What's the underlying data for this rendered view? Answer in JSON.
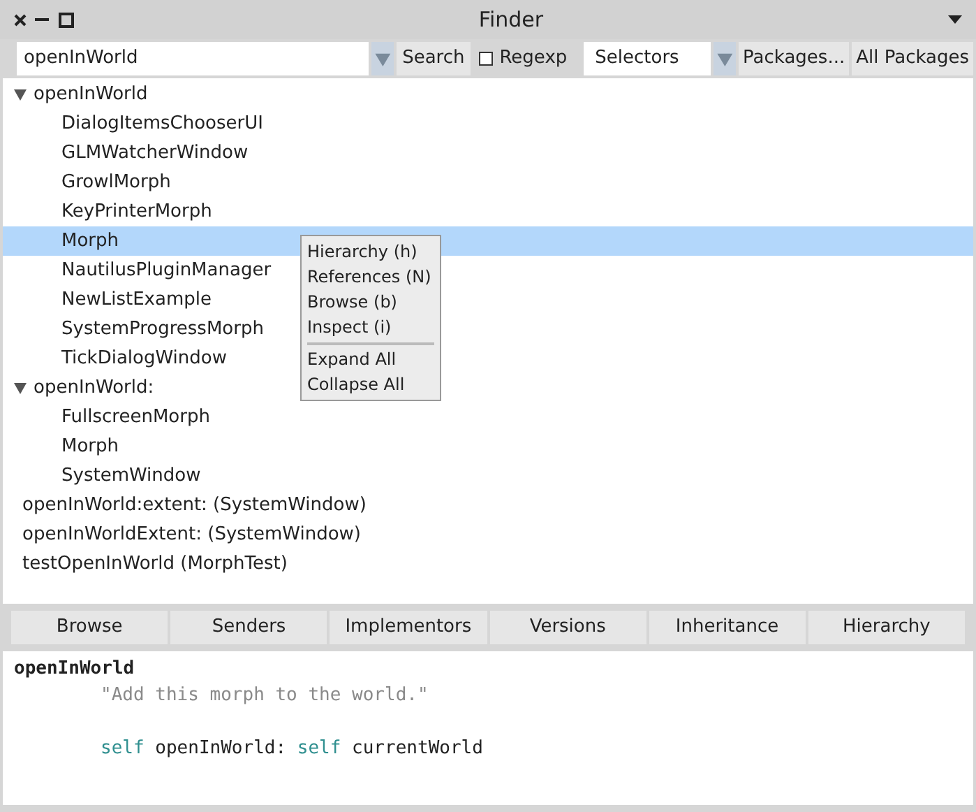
{
  "window": {
    "title": "Finder"
  },
  "toolbar": {
    "search_field": {
      "value": "openInWorld"
    },
    "search_button": "Search",
    "regexp": {
      "label": "Regexp",
      "checked": false
    },
    "mode_select": {
      "value": "Selectors"
    },
    "packages_button": "Packages...",
    "all_packages_button": "All Packages"
  },
  "tree": [
    {
      "label": "openInWorld",
      "expanded": true,
      "selected": false,
      "children": [
        {
          "label": "DialogItemsChooserUI",
          "selected": false
        },
        {
          "label": "GLMWatcherWindow",
          "selected": false
        },
        {
          "label": "GrowlMorph",
          "selected": false
        },
        {
          "label": "KeyPrinterMorph",
          "selected": false
        },
        {
          "label": "Morph",
          "selected": true
        },
        {
          "label": "NautilusPluginManager",
          "selected": false
        },
        {
          "label": "NewListExample",
          "selected": false
        },
        {
          "label": "SystemProgressMorph",
          "selected": false
        },
        {
          "label": "TickDialogWindow",
          "selected": false
        }
      ]
    },
    {
      "label": "openInWorld:",
      "expanded": true,
      "selected": false,
      "children": [
        {
          "label": "FullscreenMorph",
          "selected": false
        },
        {
          "label": "Morph",
          "selected": false
        },
        {
          "label": "SystemWindow",
          "selected": false
        }
      ]
    },
    {
      "label": "openInWorld:extent: (SystemWindow)",
      "selected": false
    },
    {
      "label": "openInWorldExtent: (SystemWindow)",
      "selected": false
    },
    {
      "label": "testOpenInWorld (MorphTest)",
      "selected": false
    }
  ],
  "context_menu": {
    "groups": [
      [
        "Hierarchy (h)",
        "References (N)",
        "Browse (b)",
        "Inspect (i)"
      ],
      [
        "Expand All",
        "Collapse All"
      ]
    ]
  },
  "action_buttons": [
    "Browse",
    "Senders",
    "Implementors",
    "Versions",
    "Inheritance",
    "Hierarchy"
  ],
  "code": [
    {
      "kind": "selector",
      "segments": [
        {
          "kind": "plain",
          "text": "openInWorld"
        }
      ]
    },
    {
      "kind": "body",
      "segments": [
        {
          "kind": "comment",
          "text": "\"Add this morph to the world.\""
        }
      ]
    },
    {
      "kind": "statement",
      "segments": [
        {
          "kind": "keyword",
          "text": "self"
        },
        {
          "kind": "plain",
          "text": " openInWorld: "
        },
        {
          "kind": "keyword",
          "text": "self"
        },
        {
          "kind": "plain",
          "text": " currentWorld"
        }
      ]
    }
  ]
}
